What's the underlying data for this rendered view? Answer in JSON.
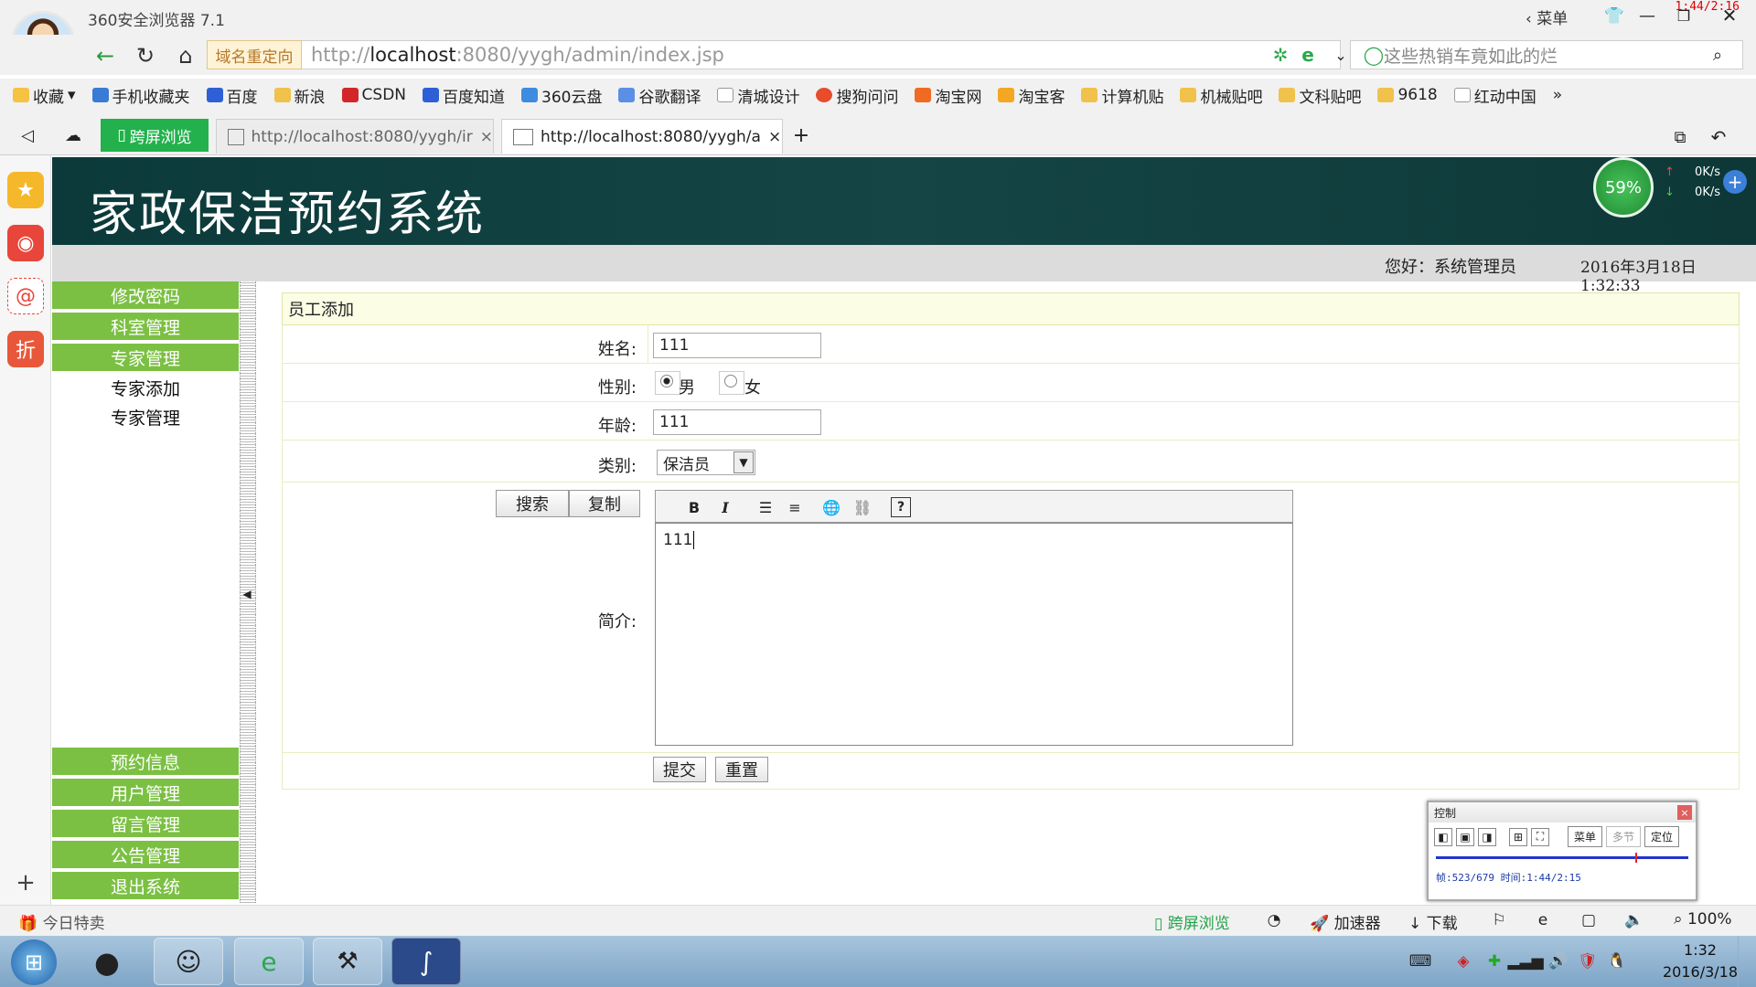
{
  "browser": {
    "app_title": "360安全浏览器 7.1",
    "menu_label": "菜单",
    "time_overlay": "1:44/2:16",
    "redirect_label": "域名重定向",
    "url_prefix": "http://",
    "url_host": "localhost",
    "url_rest": ":8080/yygh/admin/index.jsp",
    "search_placeholder": "这些热销车竟如此的烂",
    "bookmarks": [
      "收藏",
      "手机收藏夹",
      "百度",
      "新浪",
      "CSDN",
      "百度知道",
      "360云盘",
      "谷歌翻译",
      "清城设计",
      "搜狗问问",
      "淘宝网",
      "淘宝客",
      "计算机贴",
      "机械贴吧",
      "文科贴吧",
      "9618",
      "红动中国"
    ],
    "tabs": {
      "cross_screen": "跨屏浏览",
      "tab1": "http://localhost:8080/yygh/ir",
      "tab2": "http://localhost:8080/yygh/a"
    },
    "net": {
      "percent": "59%",
      "up": "0K/s",
      "down": "0K/s"
    }
  },
  "page": {
    "site_title": "家政保洁预约系统",
    "greeting": "您好：系统管理员",
    "datetime": "2016年3月18日  1:32:33",
    "menu_top": [
      "修改密码",
      "科室管理",
      "专家管理"
    ],
    "submenu": [
      "专家添加",
      "专家管理"
    ],
    "menu_bottom": [
      "预约信息",
      "用户管理",
      "留言管理",
      "公告管理",
      "退出系统"
    ],
    "form": {
      "heading": "员工添加",
      "name_label": "姓名:",
      "name_value": "111",
      "gender_label": "性别:",
      "gender_male": "男",
      "gender_female": "女",
      "age_label": "年龄:",
      "age_value": "111",
      "category_label": "类别:",
      "category_value": "保洁员",
      "bio_label": "简介:",
      "bio_value": "111",
      "search_btn": "搜索",
      "copy_btn": "复制",
      "submit_btn": "提交",
      "reset_btn": "重置"
    }
  },
  "control_panel": {
    "title": "控制",
    "menu_btn": "菜单",
    "multi_btn": "多节",
    "locate_btn": "定位",
    "status": "帧:523/679 时间:1:44/2:15"
  },
  "statusbar": {
    "deals": "今日特卖",
    "cross_screen": "跨屏浏览",
    "accelerator": "加速器",
    "download": "下载",
    "zoom": "100%"
  },
  "taskbar": {
    "time": "1:32",
    "date": "2016/3/18"
  },
  "colors": {
    "menu_green": "#7bc043",
    "banner": "#154545",
    "accent": "#22b14c"
  }
}
